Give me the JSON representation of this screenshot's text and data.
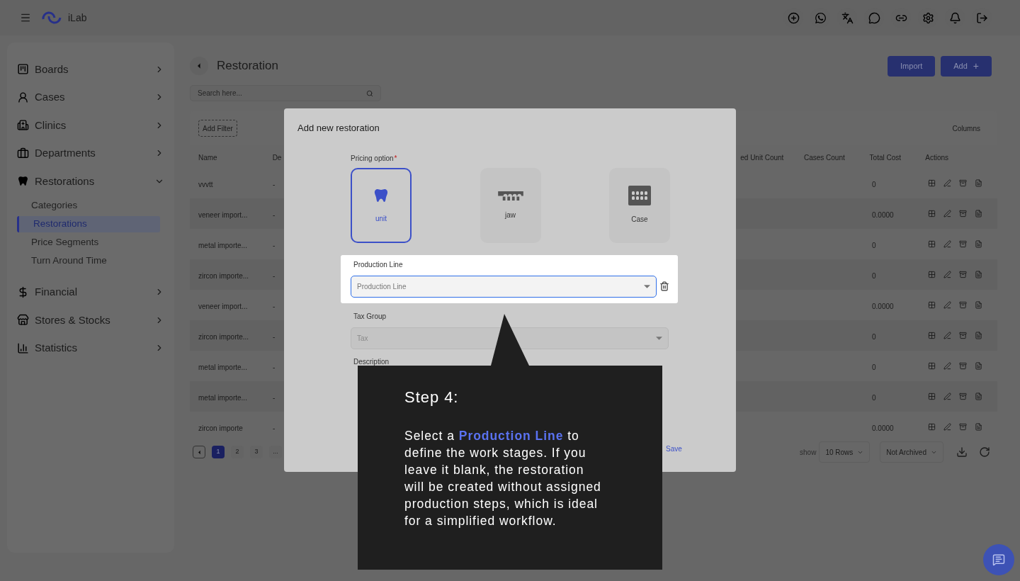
{
  "topbar": {
    "brand": "iLab"
  },
  "sidebar": {
    "items": [
      {
        "label": "Boards",
        "expanded": false
      },
      {
        "label": "Cases",
        "expanded": false
      },
      {
        "label": "Clinics",
        "expanded": false
      },
      {
        "label": "Departments",
        "expanded": false
      },
      {
        "label": "Restorations",
        "expanded": true,
        "children": [
          {
            "label": "Categories",
            "selected": false
          },
          {
            "label": "Restorations",
            "selected": true
          },
          {
            "label": "Price Segments",
            "selected": false
          },
          {
            "label": "Turn Around Time",
            "selected": false
          }
        ]
      },
      {
        "label": "Financial",
        "expanded": false
      },
      {
        "label": "Stores & Stocks",
        "expanded": false
      },
      {
        "label": "Statistics",
        "expanded": false
      }
    ]
  },
  "page": {
    "title": "Restoration",
    "buttons": [
      "Import",
      "Add"
    ],
    "add_plus": "+",
    "search": {
      "placeholder": "Search here..."
    },
    "add_filter": "Add Filter",
    "columns_button": "Columns"
  },
  "table": {
    "columns": [
      "Name",
      "De",
      "ed Unit Count",
      "Cases Count",
      "Total Cost",
      "Actions"
    ],
    "rows": [
      {
        "name": "vvvtt",
        "column_2": "-",
        "total_cost": "0"
      },
      {
        "name": "veneer import...",
        "column_2": "-",
        "total_cost": "0.0000"
      },
      {
        "name": "metal importe...",
        "column_2": "-",
        "total_cost": "0"
      },
      {
        "name": "zircon importe...",
        "column_2": "-",
        "total_cost": "0"
      },
      {
        "name": "veneer import...",
        "column_2": "-",
        "total_cost": "0.0000"
      },
      {
        "name": "zircon importe...",
        "column_2": "-",
        "total_cost": "0"
      },
      {
        "name": "metal importe...",
        "column_2": "-",
        "total_cost": "0"
      },
      {
        "name": "metal importe...",
        "column_2": "-",
        "total_cost": "0"
      },
      {
        "name": "zircon importe",
        "column_2": "-",
        "total_cost": "0.0000"
      }
    ]
  },
  "pagination": {
    "pages": [
      {
        "label": "1",
        "selected": true
      },
      {
        "label": "2",
        "selected": false
      },
      {
        "label": "3",
        "selected": false
      },
      {
        "label": "...",
        "selected": false
      }
    ],
    "show_label": "show",
    "rows_select": "10 Rows",
    "archive_select": "Not Archived"
  },
  "modal": {
    "title": "Add new restoration",
    "pricing_label": "Pricing option",
    "required_mark": "*",
    "options": [
      {
        "label": "unit",
        "selected": true
      },
      {
        "label": "jaw",
        "selected": false
      },
      {
        "label": "Case",
        "selected": false
      }
    ],
    "production_line": {
      "label": "Production Line",
      "placeholder": "Production Line"
    },
    "tax_group": {
      "label": "Tax Group",
      "placeholder": "Tax"
    },
    "description": {
      "label": "Description"
    },
    "save": "Save"
  },
  "tour": {
    "title": "Step 4:",
    "body": "Select a **Production Line** to define the work stages. If you leave it blank, the restoration will be created without assigned production steps, which is ideal for a simplified workflow."
  }
}
